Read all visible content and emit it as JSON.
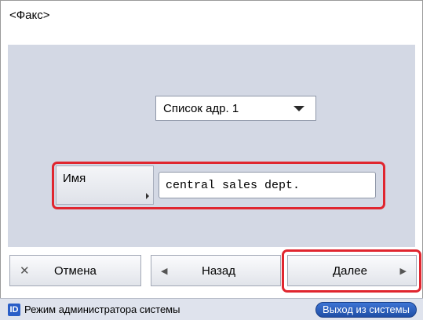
{
  "window": {
    "title": "<Факс>"
  },
  "address_book": {
    "selected": "Список адр. 1"
  },
  "name_field": {
    "button_label": "Имя",
    "value": "central sales dept."
  },
  "buttons": {
    "cancel": {
      "icon": "close-icon",
      "label": "Отмена"
    },
    "back": {
      "icon": "arrow-left-icon",
      "label": "Назад"
    },
    "next": {
      "icon": "arrow-right-icon",
      "label": "Далее"
    }
  },
  "status_bar": {
    "id_badge": "ID",
    "mode_text": "Режим администратора системы",
    "logout_label": "Выход из системы"
  },
  "colors": {
    "highlight": "#e0262f",
    "panel": "#d3d8e4",
    "accent": "#2a5ec7"
  }
}
